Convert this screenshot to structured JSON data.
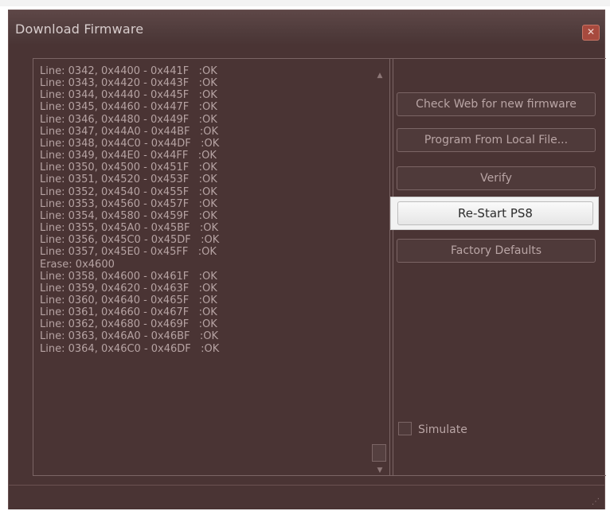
{
  "window": {
    "title": "Download Firmware",
    "close_glyph": "✕"
  },
  "log": {
    "lines": [
      "Line: 0342, 0x4400 - 0x441F   :OK",
      "Line: 0343, 0x4420 - 0x443F   :OK",
      "Line: 0344, 0x4440 - 0x445F   :OK",
      "Line: 0345, 0x4460 - 0x447F   :OK",
      "Line: 0346, 0x4480 - 0x449F   :OK",
      "Line: 0347, 0x44A0 - 0x44BF   :OK",
      "Line: 0348, 0x44C0 - 0x44DF   :OK",
      "Line: 0349, 0x44E0 - 0x44FF   :OK",
      "Line: 0350, 0x4500 - 0x451F   :OK",
      "Line: 0351, 0x4520 - 0x453F   :OK",
      "Line: 0352, 0x4540 - 0x455F   :OK",
      "Line: 0353, 0x4560 - 0x457F   :OK",
      "Line: 0354, 0x4580 - 0x459F   :OK",
      "Line: 0355, 0x45A0 - 0x45BF   :OK",
      "Line: 0356, 0x45C0 - 0x45DF   :OK",
      "Line: 0357, 0x45E0 - 0x45FF   :OK",
      "Erase: 0x4600",
      "Line: 0358, 0x4600 - 0x461F   :OK",
      "Line: 0359, 0x4620 - 0x463F   :OK",
      "Line: 0360, 0x4640 - 0x465F   :OK",
      "Line: 0361, 0x4660 - 0x467F   :OK",
      "Line: 0362, 0x4680 - 0x469F   :OK",
      "Line: 0363, 0x46A0 - 0x46BF   :OK",
      "Line: 0364, 0x46C0 - 0x46DF   :OK"
    ]
  },
  "buttons": {
    "check_web": "Check Web for new firmware",
    "program_local": "Program From Local File...",
    "verify": "Verify",
    "restart": "Re-Start PS8",
    "factory_defaults": "Factory Defaults"
  },
  "simulate": {
    "label": "Simulate",
    "checked": false
  },
  "icons": {
    "scroll_up": "▲",
    "scroll_down": "▼",
    "resize_grip": "⋰"
  },
  "colors": {
    "dim_overlay": "#4a3434",
    "highlight_button": "#f2f2f2"
  }
}
